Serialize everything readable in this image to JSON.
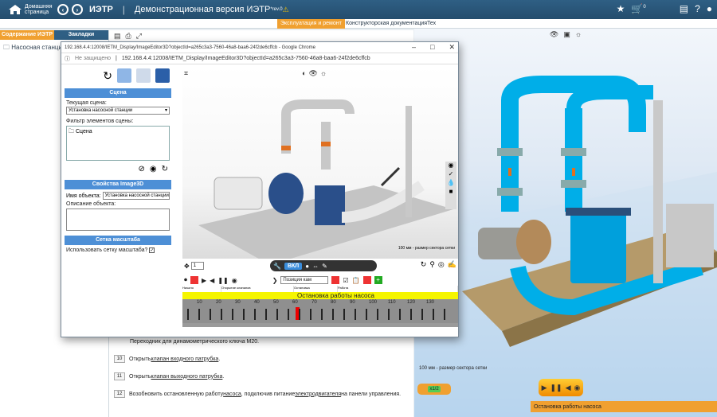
{
  "header": {
    "home_label": "Домашняя страница",
    "app_title": "ИЭТР",
    "version": "Демонстрационная версия ИЭТР",
    "rev": "*rev.0",
    "cart_count": "0"
  },
  "tabs2": [
    "Эксплуатация и ремонт",
    "Конструкторская документация",
    "Тех"
  ],
  "sidebar": {
    "tabs": [
      "Содержание ИЭТР",
      "Закладки"
    ],
    "item": "Насосная станция"
  },
  "steps": [
    {
      "num": "",
      "text": "Переходник для динамометрического ключа М20."
    },
    {
      "num": "10",
      "pre": "Открыть ",
      "link": "клапан входного патрубка",
      "post": "."
    },
    {
      "num": "11",
      "pre": "Открыть ",
      "link": "клапан выходного патрубка",
      "post": "."
    },
    {
      "num": "12",
      "pre": "Возобновить остановленную работу ",
      "link": "насоса",
      "mid": ", подключив питание ",
      "link2": "электродвигателя",
      "post": " на панели управления."
    }
  ],
  "viewer": {
    "scale_label": "100 мм - размер сектора сетки",
    "status": "Остановка работы насоса",
    "speed": "x1/2"
  },
  "popup": {
    "title": "192.168.4.4:12008/IETM_Display/ImageEditor3D?objectId=a265c3a3-7560-46a8-baa6-24f2de6cffcb - Google Chrome",
    "not_secure": "Не защищено",
    "url": "192.168.4.4:12008/IETM_Display/ImageEditor3D?objectId=a265c3a3-7560-46a8-baa6-24f2de6cffcb",
    "scene_header": "Сцена",
    "current_scene_label": "Текущая сцена:",
    "current_scene_value": "Установка насосной станции",
    "filter_label": "Фильтр элементов сцены:",
    "filter_item": "Сцена",
    "props_header": "Свойства Image3D",
    "object_name_label": "Имя объекта:",
    "object_name_value": "Установка насосной станции",
    "object_desc_label": "Описание объекта:",
    "grid_header": "Сетка масштаба",
    "use_grid_label": "Использовать сетку масштаба?",
    "scale_label": "100 мм - размер сектора сетки",
    "vkl": "ВКЛ",
    "position_label": "Позиция кам",
    "frame_select": "1",
    "timeline_status": "Остановка работы насоса",
    "timeline_ticks": [
      "10",
      "20",
      "30",
      "40",
      "50",
      "60",
      "70",
      "80",
      "90",
      "100",
      "110",
      "120",
      "130"
    ],
    "timeline_head": [
      "Начало",
      "Открытие клапанов",
      "Остановка",
      "Работа"
    ]
  },
  "colors": {
    "header_bg": "#2f5f84",
    "accent": "#f0a030",
    "pipe": "#00aee8",
    "section_head": "#4d8fd6"
  }
}
